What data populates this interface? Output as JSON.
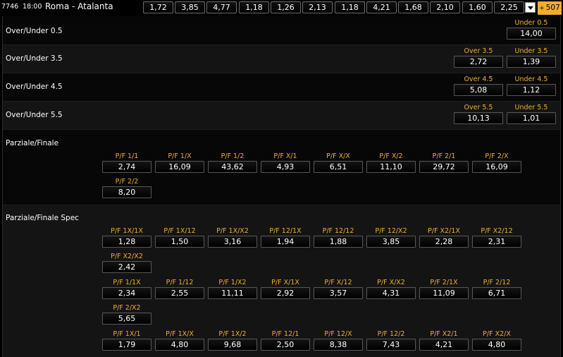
{
  "header": {
    "code": "7746",
    "time": "18:00",
    "match": "Roma - Atalanta",
    "odds": [
      "1,72",
      "3,85",
      "4,77",
      "1,18",
      "1,26",
      "2,13",
      "1,18",
      "4,21",
      "1,68",
      "2,10",
      "1,60",
      "2,25"
    ],
    "more_label": "507",
    "more_symbol": "+"
  },
  "sections": {
    "ou05": {
      "title": "Over/Under 0.5",
      "cells": [
        {
          "label": "Under 0.5",
          "value": "14,00"
        }
      ]
    },
    "ou35": {
      "title": "Over/Under 3.5",
      "cells": [
        {
          "label": "Over 3.5",
          "value": "2,72"
        },
        {
          "label": "Under 3.5",
          "value": "1,39"
        }
      ]
    },
    "ou45": {
      "title": "Over/Under 4.5",
      "cells": [
        {
          "label": "Over 4.5",
          "value": "5,08"
        },
        {
          "label": "Under 4.5",
          "value": "1,12"
        }
      ]
    },
    "ou55": {
      "title": "Over/Under 5.5",
      "cells": [
        {
          "label": "Over 5.5",
          "value": "10,13"
        },
        {
          "label": "Under 5.5",
          "value": "1,01"
        }
      ]
    },
    "pf": {
      "title": "Parziale/Finale",
      "cells": [
        {
          "label": "P/F 1/1",
          "value": "2,74"
        },
        {
          "label": "P/F 1/X",
          "value": "16,09"
        },
        {
          "label": "P/F 1/2",
          "value": "43,62"
        },
        {
          "label": "P/F X/1",
          "value": "4,93"
        },
        {
          "label": "P/F X/X",
          "value": "6,51"
        },
        {
          "label": "P/F X/2",
          "value": "11,10"
        },
        {
          "label": "P/F 2/1",
          "value": "29,72"
        },
        {
          "label": "P/F 2/X",
          "value": "16,09"
        },
        {
          "label": "P/F 2/2",
          "value": "8,20"
        }
      ]
    },
    "pfs": {
      "title": "Parziale/Finale Spec",
      "cells": [
        {
          "label": "P/F 1X/1X",
          "value": "1,28"
        },
        {
          "label": "P/F 1X/12",
          "value": "1,50"
        },
        {
          "label": "P/F 1X/X2",
          "value": "3,16"
        },
        {
          "label": "P/F 12/1X",
          "value": "1,94"
        },
        {
          "label": "P/F 12/12",
          "value": "1,88"
        },
        {
          "label": "P/F 12/X2",
          "value": "3,85"
        },
        {
          "label": "P/F X2/1X",
          "value": "2,28"
        },
        {
          "label": "P/F X2/12",
          "value": "2,31"
        },
        {
          "label": "P/F X2/X2",
          "value": "2,42"
        },
        {
          "label": "P/F 1/1X",
          "value": "2,34"
        },
        {
          "label": "P/F 1/12",
          "value": "2,55"
        },
        {
          "label": "P/F 1/X2",
          "value": "11,11"
        },
        {
          "label": "P/F X/1X",
          "value": "2,92"
        },
        {
          "label": "P/F X/12",
          "value": "3,57"
        },
        {
          "label": "P/F X/X2",
          "value": "4,31"
        },
        {
          "label": "P/F 2/1X",
          "value": "11,09"
        },
        {
          "label": "P/F 2/12",
          "value": "6,71"
        },
        {
          "label": "P/F 2/X2",
          "value": "5,65"
        },
        {
          "label": "P/F 1X/1",
          "value": "1,79"
        },
        {
          "label": "P/F 1X/X",
          "value": "4,80"
        },
        {
          "label": "P/F 1X/2",
          "value": "9,68"
        },
        {
          "label": "P/F 12/1",
          "value": "2,50"
        },
        {
          "label": "P/F 12/X",
          "value": "8,38"
        },
        {
          "label": "P/F 12/2",
          "value": "7,43"
        },
        {
          "label": "P/F X2/1",
          "value": "4,21"
        },
        {
          "label": "P/F X2/X",
          "value": "4,80"
        }
      ]
    }
  },
  "colors": {
    "accent": "#f0ae2c",
    "background": "#000000",
    "row_alt": "#141414"
  },
  "icons": {
    "expand": "chevron-down-icon"
  }
}
